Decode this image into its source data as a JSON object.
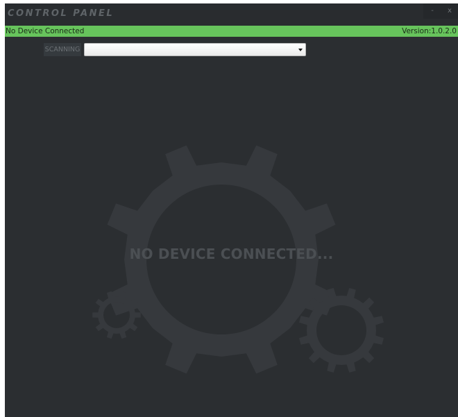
{
  "window": {
    "title": "CONTROL PANEL",
    "minimize_label": "-",
    "close_label": "x"
  },
  "status_bar": {
    "status": "No Device Connected",
    "version": "Version:1.0.2.0",
    "color": "#67c45c"
  },
  "device_picker": {
    "scan_label": "SCANNING",
    "selected_value": ""
  },
  "main": {
    "empty_message": "NO DEVICE CONNECTED...",
    "icons": [
      "gear-large-icon",
      "gear-small-left-icon",
      "gear-small-right-icon"
    ]
  },
  "colors": {
    "background": "#2b2e31",
    "gear": "#36393d",
    "accent": "#67c45c"
  }
}
